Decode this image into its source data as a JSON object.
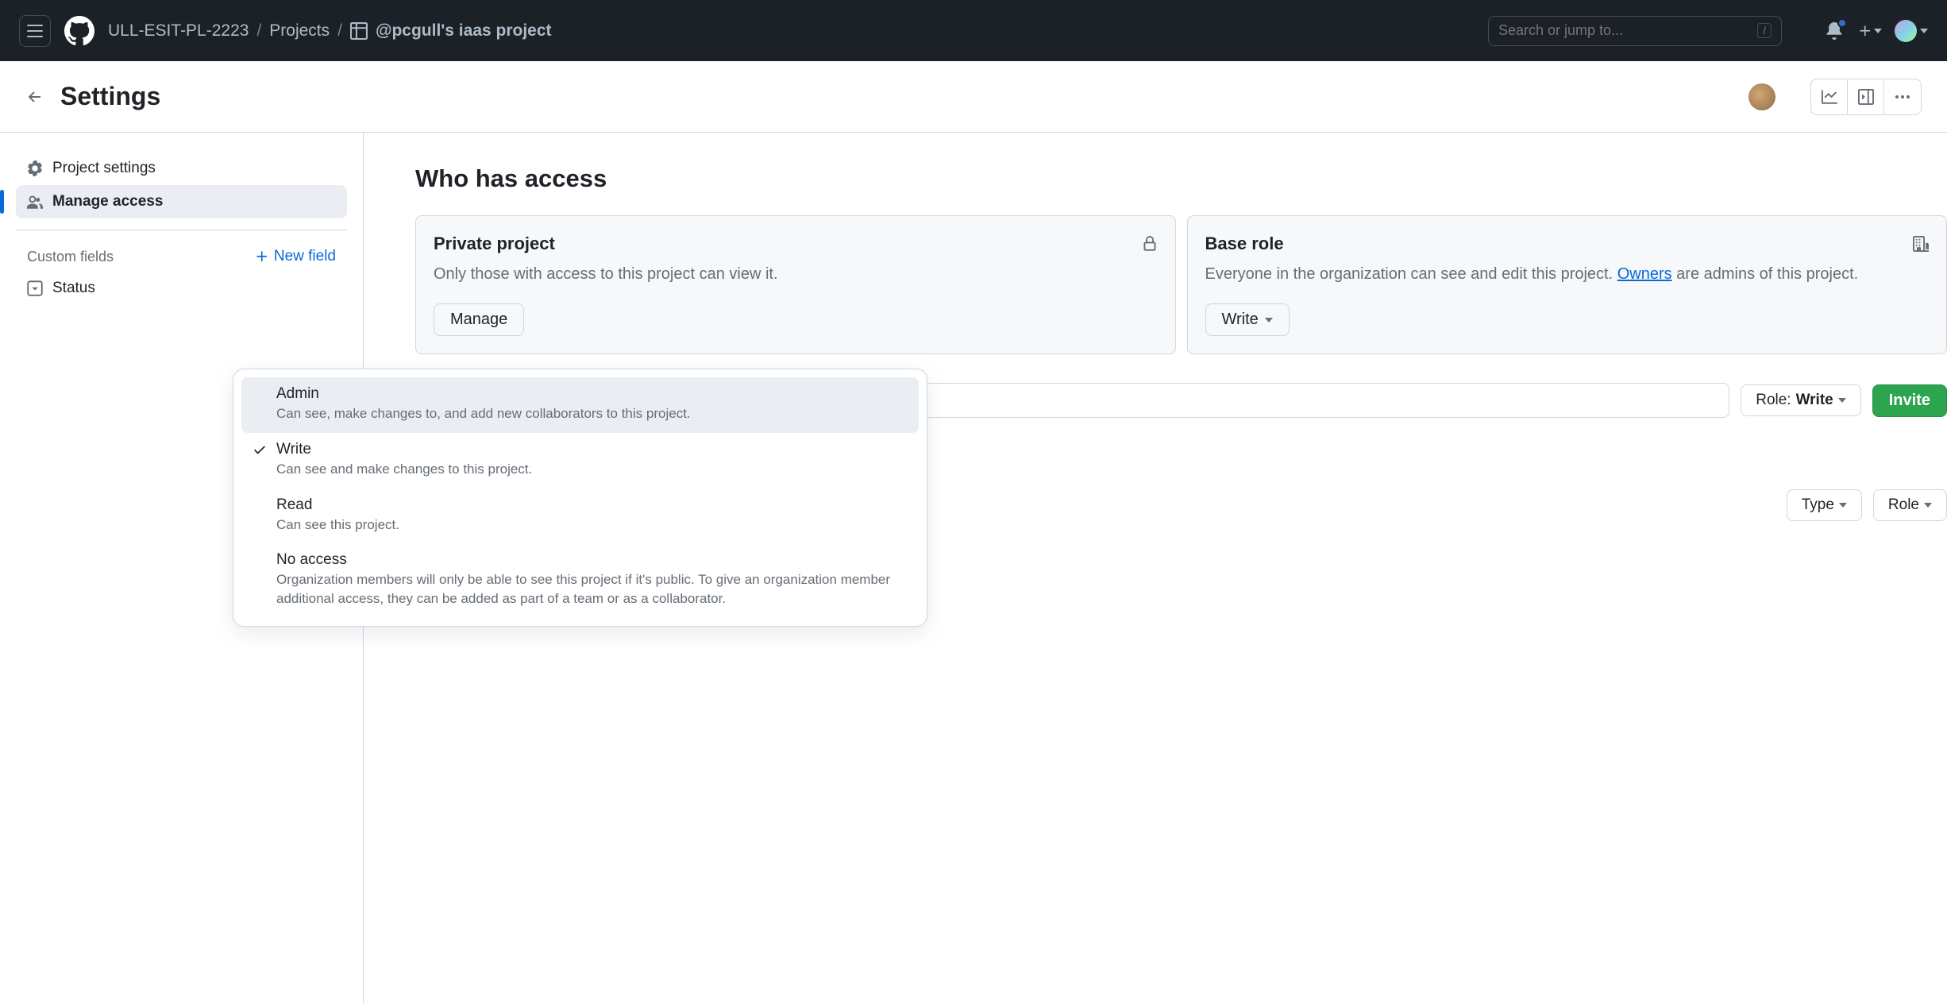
{
  "header": {
    "org": "ULL-ESIT-PL-2223",
    "projects": "Projects",
    "project_name": "@pcgull's iaas project",
    "search_placeholder": "Search or jump to...",
    "search_key": "/"
  },
  "subheader": {
    "title": "Settings"
  },
  "sidebar": {
    "project_settings": "Project settings",
    "manage_access": "Manage access",
    "custom_fields": "Custom fields",
    "new_field": "New field",
    "status": "Status"
  },
  "main": {
    "heading": "Who has access",
    "private_card": {
      "title": "Private project",
      "body": "Only those with access to this project can view it.",
      "button": "Manage"
    },
    "base_role_card": {
      "title": "Base role",
      "body_prefix": "Everyone in the organization can see and edit this project. ",
      "owners_link": "Owners",
      "body_suffix": " are admins of this project.",
      "button": "Write"
    },
    "invite": {
      "role_prefix": "Role:",
      "role_value": "Write",
      "invite_button": "Invite"
    },
    "filters": {
      "type": "Type",
      "role": "Role"
    }
  },
  "popup": {
    "items": [
      {
        "title": "Admin",
        "desc": "Can see, make changes to, and add new collaborators to this project.",
        "selected": false,
        "hover": true
      },
      {
        "title": "Write",
        "desc": "Can see and make changes to this project.",
        "selected": true,
        "hover": false
      },
      {
        "title": "Read",
        "desc": "Can see this project.",
        "selected": false,
        "hover": false
      },
      {
        "title": "No access",
        "desc": "Organization members will only be able to see this project if it's public. To give an organization member additional access, they can be added as part of a team or as a collaborator.",
        "selected": false,
        "hover": false
      }
    ]
  }
}
